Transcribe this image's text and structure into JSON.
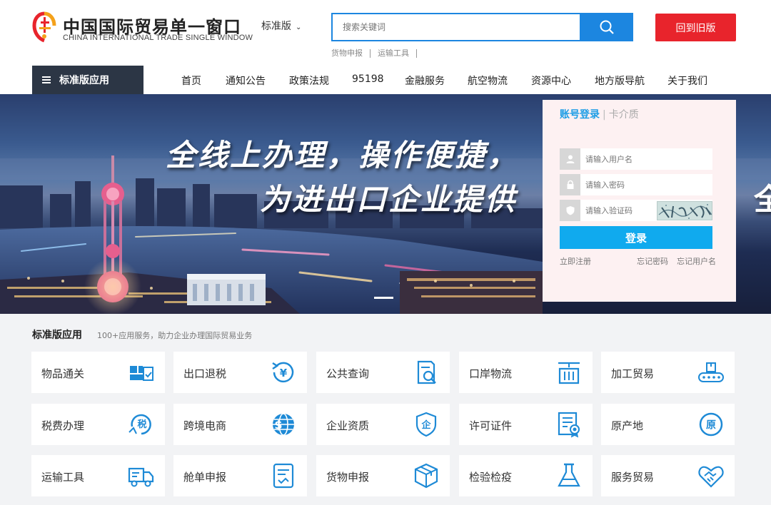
{
  "header": {
    "logo_cn": "中国国际贸易单一窗口",
    "logo_en": "CHINA INTERNATIONAL TRADE SINGLE WINDOW",
    "edition": "标准版",
    "search_placeholder": "搜索关键词",
    "hot_links": [
      "货物申报",
      "运输工具"
    ],
    "old_version": "回到旧版"
  },
  "nav": {
    "category": "标准版应用",
    "items": [
      "首页",
      "通知公告",
      "政策法规",
      "95198",
      "金融服务",
      "航空物流",
      "资源中心",
      "地方版导航",
      "关于我们"
    ]
  },
  "banner": {
    "slogan_line1": "全线上办理，操作便捷，",
    "slogan_line2": "为进出口企业提供",
    "slogan_edge": "全"
  },
  "login": {
    "tab_active": "账号登录",
    "tab_inactive": "卡介质",
    "username_placeholder": "请输入用户名",
    "password_placeholder": "请输入密码",
    "captcha_placeholder": "请输入验证码",
    "submit": "登录",
    "register": "立即注册",
    "forgot_password": "忘记密码",
    "forgot_username": "忘记用户名"
  },
  "apps": {
    "title": "标准版应用",
    "subtitle": "100+应用服务，助力企业办理国际贸易业务",
    "items": [
      {
        "label": "物品通关",
        "icon": "goods-clearance-icon"
      },
      {
        "label": "出口退税",
        "icon": "tax-refund-icon"
      },
      {
        "label": "公共查询",
        "icon": "public-query-icon"
      },
      {
        "label": "口岸物流",
        "icon": "port-logistics-icon"
      },
      {
        "label": "加工贸易",
        "icon": "processing-trade-icon"
      },
      {
        "label": "税费办理",
        "icon": "tax-payment-icon"
      },
      {
        "label": "跨境电商",
        "icon": "cross-border-ecommerce-icon"
      },
      {
        "label": "企业资质",
        "icon": "enterprise-qualification-icon"
      },
      {
        "label": "许可证件",
        "icon": "license-certificate-icon"
      },
      {
        "label": "原产地",
        "icon": "origin-icon"
      },
      {
        "label": "运输工具",
        "icon": "truck-icon"
      },
      {
        "label": "舱单申报",
        "icon": "manifest-icon"
      },
      {
        "label": "货物申报",
        "icon": "cargo-box-icon"
      },
      {
        "label": "检验检疫",
        "icon": "flask-icon"
      },
      {
        "label": "服务贸易",
        "icon": "handshake-icon"
      }
    ]
  },
  "colors": {
    "primary_blue": "#1c86e0",
    "accent_cyan": "#10aaee",
    "old_button_red": "#e8242c",
    "nav_dark": "#2c3645",
    "login_bg": "#fdf1f2",
    "icon_blue": "#1e8ad6"
  }
}
